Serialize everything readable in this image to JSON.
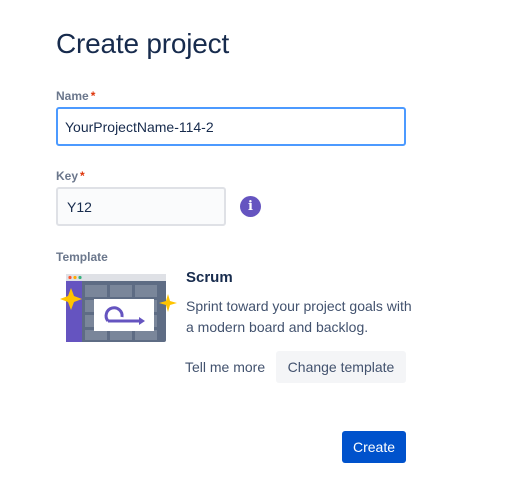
{
  "page": {
    "title": "Create project"
  },
  "form": {
    "name": {
      "label": "Name",
      "required_mark": "*",
      "value": "YourProjectName-114-2"
    },
    "key": {
      "label": "Key",
      "required_mark": "*",
      "value": "Y12",
      "info_icon": "info-icon"
    },
    "template": {
      "label": "Template",
      "name": "Scrum",
      "description": "Sprint toward your project goals with a modern board and backlog.",
      "illustration_icon": "scrum-loop-icon",
      "tell_more_label": "Tell me more",
      "change_label": "Change template"
    }
  },
  "actions": {
    "create_label": "Create"
  },
  "colors": {
    "primary": "#0052cc",
    "focus_border": "#4c9aff",
    "required": "#de350b",
    "info": "#6554c0",
    "template_accent": "#6554c0",
    "sparkle": "#ffc400"
  }
}
